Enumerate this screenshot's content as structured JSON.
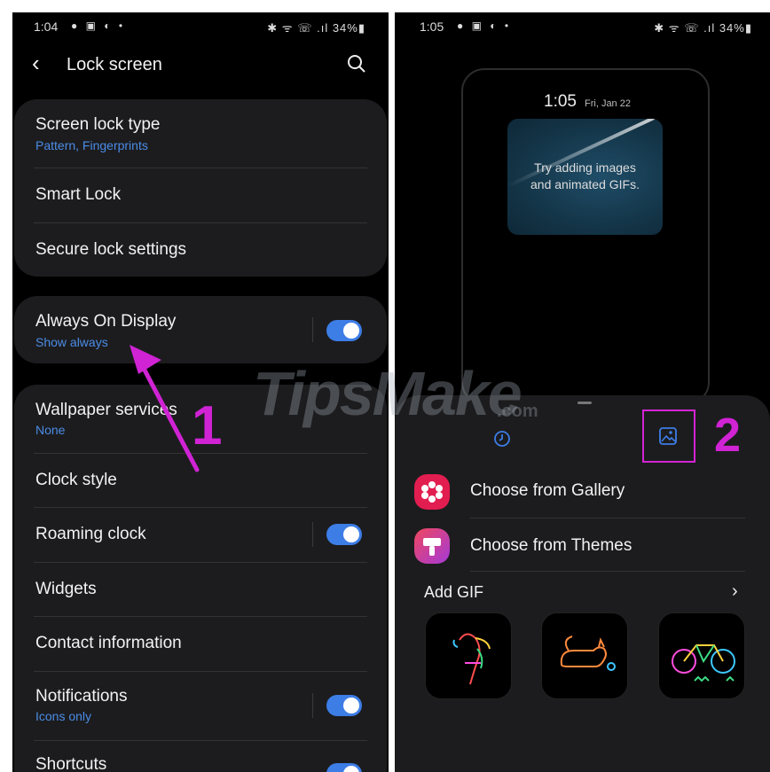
{
  "left": {
    "status": {
      "time": "1:04",
      "icons": "● ▣ ◐ •",
      "right": "✱ ᯤ ☏ .ıl 34%▮"
    },
    "header": {
      "title": "Lock screen"
    },
    "card1": [
      {
        "label": "Screen lock type",
        "sub": "Pattern, Fingerprints"
      },
      {
        "label": "Smart Lock"
      },
      {
        "label": "Secure lock settings"
      }
    ],
    "aod": {
      "label": "Always On Display",
      "sub": "Show always",
      "toggle": true
    },
    "card3": [
      {
        "label": "Wallpaper services",
        "sub": "None"
      },
      {
        "label": "Clock style"
      },
      {
        "label": "Roaming clock",
        "toggle": true
      },
      {
        "label": "Widgets"
      },
      {
        "label": "Contact information"
      },
      {
        "label": "Notifications",
        "sub": "Icons only",
        "toggle": true
      },
      {
        "label": "Shortcuts",
        "toggle": true
      }
    ],
    "annotation_number": "1"
  },
  "right": {
    "status": {
      "time": "1:05",
      "icons": "● ▣ ◐ •",
      "right": "✱ ᯤ ☏ .ıl 34%▮"
    },
    "preview": {
      "time": "1:05",
      "date": "Fri, Jan 22",
      "message_line1": "Try adding images",
      "message_line2": "and animated GIFs."
    },
    "options": [
      {
        "label": "Choose from Gallery",
        "icon": "gallery-flower-icon"
      },
      {
        "label": "Choose from Themes",
        "icon": "themes-brush-icon"
      }
    ],
    "add_gif": "Add GIF",
    "gifs": [
      "parrot-neon-icon",
      "cat-neon-icon",
      "bicycle-neon-icon"
    ],
    "annotation_number": "2"
  },
  "watermark": {
    "brand": "TipsMake",
    "suffix": ".com"
  },
  "colors": {
    "accent": "#3d7de6",
    "sub_text": "#4b8ce6",
    "annotation": "#d023d4",
    "card": "#1c1c1e"
  }
}
